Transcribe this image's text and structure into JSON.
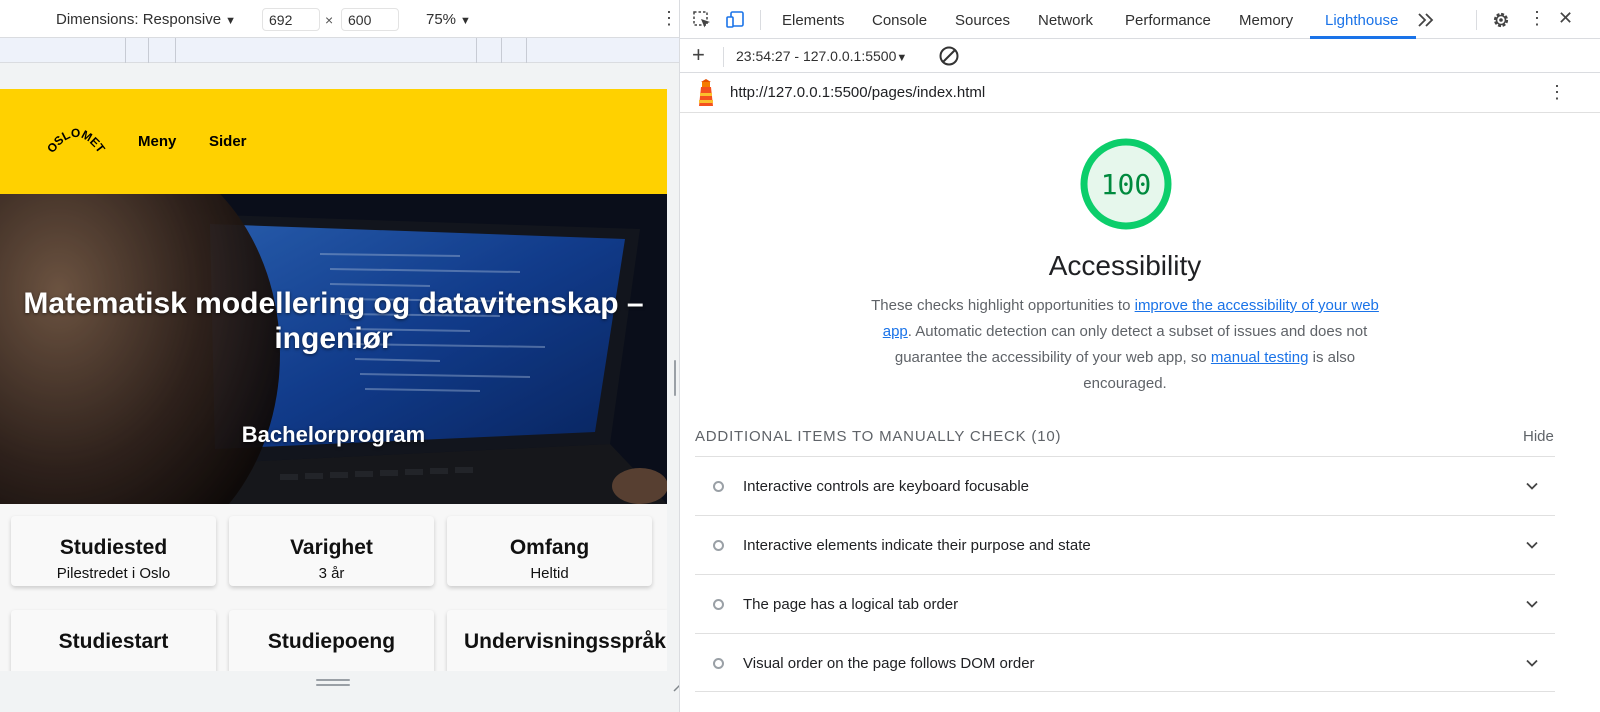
{
  "device_toolbar": {
    "dimensions_label": "Dimensions: Responsive",
    "width": "692",
    "height": "600",
    "times": "×",
    "zoom": "75%"
  },
  "site": {
    "logo_text": "OSLOMET",
    "nav": [
      "Meny",
      "Sider"
    ],
    "hero_title": "Matematisk modellering og datavitenskap – ingeniør",
    "hero_subtitle": "Bachelorprogram",
    "facts": [
      {
        "title": "Studiested",
        "value": "Pilestredet i Oslo"
      },
      {
        "title": "Varighet",
        "value": "3 år"
      },
      {
        "title": "Omfang",
        "value": "Heltid"
      },
      {
        "title": "Studiestart",
        "value": ""
      },
      {
        "title": "Studiepoeng",
        "value": ""
      },
      {
        "title": "Undervisningsspråk",
        "value": ""
      }
    ],
    "colors": {
      "header_bg": "#ffd100"
    }
  },
  "devtools": {
    "tabs": [
      "Elements",
      "Console",
      "Sources",
      "Network",
      "Performance",
      "Memory",
      "Lighthouse"
    ],
    "active_tab": "Lighthouse",
    "accent": "#1a73e8"
  },
  "lighthouse": {
    "report_select": "23:54:27 - 127.0.0.1:5500",
    "url": "http://127.0.0.1:5500/pages/index.html",
    "score": "100",
    "score_color": "#0cce6b",
    "category": "Accessibility",
    "desc_part1": "These checks highlight opportunities to ",
    "desc_link1": "improve the accessibility of your web app",
    "desc_part2": ". Automatic detection can only detect a subset of issues and does not guarantee the accessibility of your web app, so ",
    "desc_link2": "manual testing",
    "desc_part3": " is also encouraged.",
    "manual_title": "ADDITIONAL ITEMS TO MANUALLY CHECK",
    "manual_count": "(10)",
    "hide_label": "Hide",
    "audits": [
      "Interactive controls are keyboard focusable",
      "Interactive elements indicate their purpose and state",
      "The page has a logical tab order",
      "Visual order on the page follows DOM order"
    ]
  }
}
